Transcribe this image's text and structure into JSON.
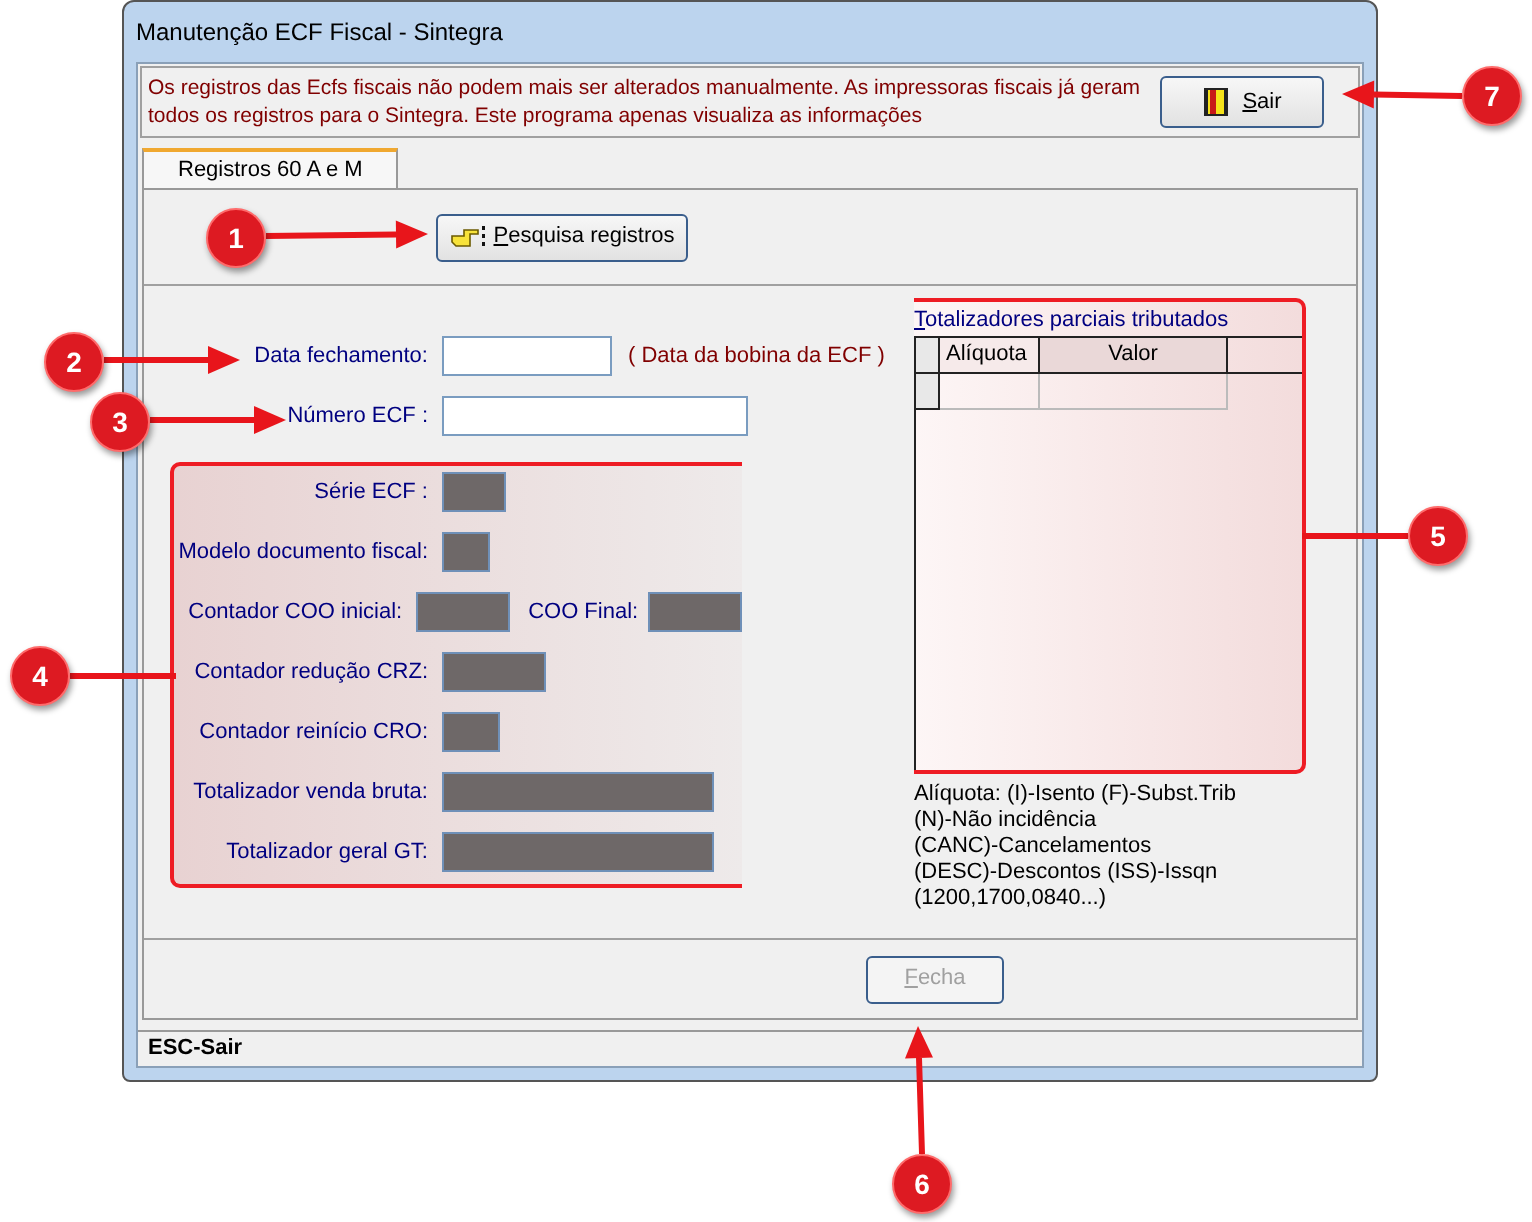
{
  "window": {
    "title": "Manutenção ECF Fiscal - Sintegra"
  },
  "notice": {
    "text": "Os registros das Ecfs fiscais não podem mais ser alterados manualmente. As impressoras fiscais já geram todos os registros para o Sintegra. Este programa apenas visualiza as informações"
  },
  "exit_button": {
    "label": "Sair"
  },
  "tabs": [
    {
      "label": "Registros 60 A e M",
      "selected": true
    }
  ],
  "search_button": {
    "label": "Pesquisa registros"
  },
  "inputs": [
    {
      "label": "Data fechamento:",
      "hint": "( Data da bobina da ECF )"
    },
    {
      "label": "Número ECF :"
    }
  ],
  "readonly_fields": [
    {
      "label": "Série ECF :"
    },
    {
      "label": "Modelo documento fiscal:"
    },
    {
      "label": "Contador COO inicial:",
      "second_label": "COO Final:"
    },
    {
      "label": "Contador redução CRZ:"
    },
    {
      "label": "Contador reinício CRO:"
    },
    {
      "label": "Totalizador venda bruta:"
    },
    {
      "label": "Totalizador geral GT:"
    }
  ],
  "totalizers": {
    "title": "Totalizadores parciais tributados",
    "columns": [
      "Alíquota",
      "Valor"
    ]
  },
  "legend": [
    "Alíquota: (I)-Isento (F)-Subst.Trib",
    "(N)-Não incidência",
    "(CANC)-Cancelamentos",
    "(DESC)-Descontos (ISS)-Issqn",
    "(1200,1700,0840...)"
  ],
  "close_button": {
    "label": "Fecha",
    "disabled": true
  },
  "status_bar": {
    "text": "ESC-Sair"
  },
  "callouts": [
    {
      "number": "1"
    },
    {
      "number": "2"
    },
    {
      "number": "3"
    },
    {
      "number": "4"
    },
    {
      "number": "5"
    },
    {
      "number": "6"
    },
    {
      "number": "7"
    }
  ]
}
